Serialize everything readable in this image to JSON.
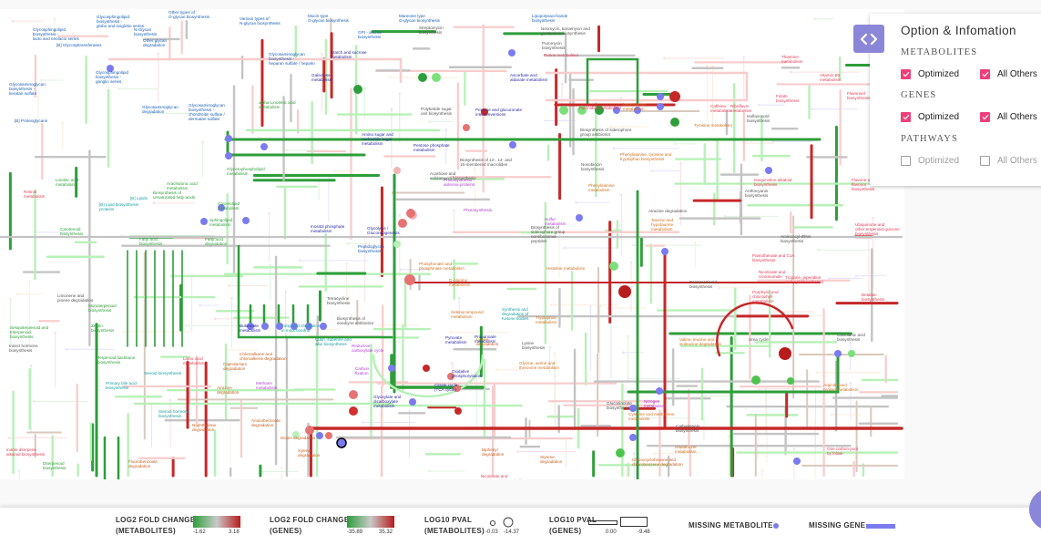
{
  "panel": {
    "title": "Option & Infomation",
    "toggle_icon": "code-brackets-icon",
    "sections": [
      {
        "name": "METABOLITES",
        "options": [
          {
            "label": "Optimized",
            "checked": true
          },
          {
            "label": "All Others",
            "checked": true
          }
        ]
      },
      {
        "name": "GENES",
        "options": [
          {
            "label": "Optimized",
            "checked": true
          },
          {
            "label": "All Others",
            "checked": true
          }
        ]
      },
      {
        "name": "PATHWAYS",
        "options": [
          {
            "label": "Optimized",
            "checked": false
          },
          {
            "label": "All Others",
            "checked": false
          }
        ]
      }
    ]
  },
  "legend": {
    "fc_metabolites": {
      "title1": "LOG2 FOLD CHANGE",
      "title2": "(METABOLITES)",
      "min": "-1.62",
      "max": "3.18"
    },
    "fc_genes": {
      "title1": "LOG2 FOLD CHANGE",
      "title2": "(GENES)",
      "min": "-35.89",
      "max": "35.32"
    },
    "pval_metabolites": {
      "title1": "LOG10 PVAL",
      "title2": "(METABOLITES)",
      "min": "-0.03",
      "max": "-14.37"
    },
    "pval_genes": {
      "title1": "LOG10 PVAL",
      "title2": "(GENES)",
      "min": "0.00",
      "max": "-9.48"
    },
    "missing_metabolite": "MISSING METABOLITE",
    "missing_gene": "MISSING GENE"
  },
  "colors": {
    "accent": "#8b87d8",
    "checkbox": "#ef3f7b",
    "up": "#c62828",
    "down": "#2e9e3a",
    "missing": "#7b7bf0",
    "neutral": "#c4c4c4"
  },
  "pathways": [
    {
      "text": "Glycosphingolipid\nbiosynthesis -\nglobo and isoglobo series",
      "color": "#1a5fb4"
    },
    {
      "text": "Other types of\nO-glycan biosynthesis",
      "color": "#1a5fb4"
    },
    {
      "text": "Various types of\nN-glycan biosynthesis",
      "color": "#1a5fb4"
    },
    {
      "text": "Mucin type\nO-glycan biosynthesis",
      "color": "#1a5fb4"
    },
    {
      "text": "Mannose type\nO-glycan biosynthesis",
      "color": "#1a5fb4"
    },
    {
      "text": "Lipopolysaccharide\nbiosynthesis",
      "color": "#1a5fb4"
    },
    {
      "text": "Glycosphingolipid\nbiosynthesis -\nlacto and neolacto series",
      "color": "#1a5fb4"
    },
    {
      "text": "N-Glycan\nbiosynthesis",
      "color": "#1a5fb4"
    },
    {
      "text": "[B] Glycosyltransferases",
      "color": "#1a5fb4"
    },
    {
      "text": "Other glycan\ndegradation",
      "color": "#1a5fb4"
    },
    {
      "text": "Glycosphingolipid\nbiosynthesis -\nganglio series",
      "color": "#1a5fb4"
    },
    {
      "text": "Glycosaminoglycan\nbiosynthesis -\nheparan sulfate / heparin",
      "color": "#1a5fb4"
    },
    {
      "text": "GPI - anchor\nbiosynthesis",
      "color": "#1a5fb4"
    },
    {
      "text": "Streptomycin\nbiosynthesis",
      "color": "#555555"
    },
    {
      "text": "Neomycin, kanamycin and\ngentamicin biosynthesis",
      "color": "#555555"
    },
    {
      "text": "Puromycin\nbiosynthesis",
      "color": "#555555"
    },
    {
      "text": "Purine metabolism",
      "color": "#e0405a"
    },
    {
      "text": "Starch and sucrose\nmetabolism",
      "color": "#2a2aa0"
    },
    {
      "text": "Galactose\nmetabolism",
      "color": "#2a2aa0"
    },
    {
      "text": "Ascorbate and\naldarate metabolism",
      "color": "#2a2aa0"
    },
    {
      "text": "Glycosaminoglycan\nbiosynthesis -\nkeratan sulfate",
      "color": "#1a5fb4"
    },
    {
      "text": "[B] Proteoglycans",
      "color": "#1a5fb4"
    },
    {
      "text": "Glycosaminoglycan\ndegradation",
      "color": "#1a5fb4"
    },
    {
      "text": "Glycosaminoglycan\nbiosynthesis -\nchondroitin sulfate /\ndermatan sulfate",
      "color": "#1a5fb4"
    },
    {
      "text": "alpha-Linolenic acid\nmetabolism",
      "color": "#2e9e3a"
    },
    {
      "text": "Polyketide sugar\nunit biosynthesis",
      "color": "#555555"
    },
    {
      "text": "Pentose and glucuronate\ninterconversions",
      "color": "#2a2aa0"
    },
    {
      "text": "Pyrimidine metabolism",
      "color": "#e0405a"
    },
    {
      "text": "beta-Alanine\nmetabolism",
      "color": "#d07020"
    },
    {
      "text": "Caffeine\nmetabolism",
      "color": "#e0405a"
    },
    {
      "text": "Riboflavin\nmetabolism",
      "color": "#e0405a"
    },
    {
      "text": "Thiamine\nmetabolism",
      "color": "#e0405a"
    },
    {
      "text": "Folate\nbiosynthesis",
      "color": "#e0405a"
    },
    {
      "text": "Vitamin B6\nmetabolism",
      "color": "#e0405a"
    },
    {
      "text": "Flavonoid\nbiosynthesis",
      "color": "#e0405a"
    },
    {
      "text": "Isoflavonoid\nbiosynthesis",
      "color": "#555555"
    },
    {
      "text": "Tyrosine metabolism",
      "color": "#d07020"
    },
    {
      "text": "Biosynthesis of siderophore\ngroup antibiotics",
      "color": "#555555"
    },
    {
      "text": "Amino sugar and\nnucleotide sugar\nmetabolism",
      "color": "#2a2aa0"
    },
    {
      "text": "Pentose phosphate\nmetabolism",
      "color": "#2a2aa0"
    },
    {
      "text": "Biosynthesis of 12-, 14- and\n16-membered macrolides",
      "color": "#555555"
    },
    {
      "text": "Acarbose and\nvalidamycin biosynthesis",
      "color": "#555555"
    },
    {
      "text": "Photosynthesis -\nantenna proteins",
      "color": "#b040d0"
    },
    {
      "text": "Photosynthesis",
      "color": "#b040d0"
    },
    {
      "text": "Phenylalanine, tyrosine and\ntryptophan biosynthesis",
      "color": "#d07020"
    },
    {
      "text": "Phenylalanine\nmetabolism",
      "color": "#d07020"
    },
    {
      "text": "Novobiocin\nbiosynthesis",
      "color": "#555555"
    },
    {
      "text": "Linoleic acid\nmetabolism",
      "color": "#2e9e3a"
    },
    {
      "text": "Retinol\nmetabolism",
      "color": "#e0405a"
    },
    {
      "text": "Arachidonic acid\nmetabolism",
      "color": "#2e9e3a"
    },
    {
      "text": "Biosynthesis of\nunsaturated fatty acids",
      "color": "#2e9e3a"
    },
    {
      "text": "[B] Lipids",
      "color": "#1aa0a0"
    },
    {
      "text": "[B] Lipid biosynthesis\nproteins",
      "color": "#1aa0a0"
    },
    {
      "text": "Glycerophospholipid\nmetabolism",
      "color": "#2e9e3a"
    },
    {
      "text": "Glycerolipid\nmetabolism",
      "color": "#2e9e3a"
    },
    {
      "text": "Sphingolipid\nmetabolism",
      "color": "#2e9e3a"
    },
    {
      "text": "Inositol phosphate\nmetabolism",
      "color": "#2a2aa0"
    },
    {
      "text": "Glycolysis /\nGluconeogenesis",
      "color": "#2a2aa0"
    },
    {
      "text": "Peptidoglycan\nbiosynthesis",
      "color": "#1a5fb4"
    },
    {
      "text": "Pyruvate\nmetabolism",
      "color": "#2a2aa0"
    },
    {
      "text": "Carotenoid\nbiosynthesis",
      "color": "#2e9e3a"
    },
    {
      "text": "Fatty acid\nbiosynthesis",
      "color": "#2e9e3a"
    },
    {
      "text": "Fatty acid\ndegradation",
      "color": "#2e9e3a"
    },
    {
      "text": "Sulfur\nmetabolism",
      "color": "#b040d0"
    },
    {
      "text": "Biosynthesis of\nsiderophore group\nnonribosomal\npeptides",
      "color": "#555555"
    },
    {
      "text": "Phosphonate and\nphosphinate metabolism",
      "color": "#d07020"
    },
    {
      "text": "D-Alanine\nmetabolism",
      "color": "#d07020"
    },
    {
      "text": "Histidine metabolism",
      "color": "#d07020"
    },
    {
      "text": "Taurine and\nhypotaurine\nmetabolism",
      "color": "#d07020"
    },
    {
      "text": "Atrazine degradation",
      "color": "#555555"
    },
    {
      "text": "Limonene and\npinene degradation",
      "color": "#555555"
    },
    {
      "text": "Monoterpenoid\nbiosynthesis",
      "color": "#2e9e3a"
    },
    {
      "text": "Zeatin\nbiosynthesis",
      "color": "#2e9e3a"
    },
    {
      "text": "Sesquiterpenoid and\ntriterpenoid\nbiosynthesis",
      "color": "#2e9e3a"
    },
    {
      "text": "Insect hormone\nbiosynthesis",
      "color": "#555555"
    },
    {
      "text": "Terpenoid backbone\nbiosynthesis",
      "color": "#2e9e3a"
    },
    {
      "text": "Butanoate\nmetabolism",
      "color": "#2a2aa0"
    },
    {
      "text": "Fatty acid elongation\nin mitochondria",
      "color": "#1aa0a0"
    },
    {
      "text": "Tetracycline\nbiosynthesis",
      "color": "#555555"
    },
    {
      "text": "Biosynthesis of\nenediyne antibiotics",
      "color": "#555555"
    },
    {
      "text": "Cutin, suberine and\nwax biosynthesis",
      "color": "#1aa0a0"
    },
    {
      "text": "Reductive\ncarboxylate cycle",
      "color": "#b040d0"
    },
    {
      "text": "Carbon\nfixation",
      "color": "#b040d0"
    },
    {
      "text": "Chloroalkane and\nchloroalkene degradation",
      "color": "#c86020"
    },
    {
      "text": "Lipoic acid\nmetabolism",
      "color": "#e0405a"
    },
    {
      "text": "Caprolactam\ndegradation",
      "color": "#c86020"
    },
    {
      "text": "Steroid biosynthesis",
      "color": "#1aa0a0"
    },
    {
      "text": "Primary bile acid\nbiosynthesis",
      "color": "#1aa0a0"
    },
    {
      "text": "Steroid hormone\nbiosynthesis",
      "color": "#1aa0a0"
    },
    {
      "text": "Atrazine\ndegradation",
      "color": "#c86020"
    },
    {
      "text": "Methane\nmetabolism",
      "color": "#b040d0"
    },
    {
      "text": "Naphthalene\ndegradation",
      "color": "#c86020"
    },
    {
      "text": "Aminobenzoate\ndegradation",
      "color": "#c86020"
    },
    {
      "text": "Dioxin degradation",
      "color": "#c86020"
    },
    {
      "text": "Xylene\ndegradation",
      "color": "#c86020"
    },
    {
      "text": "Fluorobenzoate\ndegradation",
      "color": "#c86020"
    },
    {
      "text": "Indole diterpene\nalkaloid biosynthesis",
      "color": "#e0405a"
    },
    {
      "text": "Diterpenoid\nbiosynthesis",
      "color": "#2e9e3a"
    },
    {
      "text": "Glyoxylate and\ndicarboxylate\nmetabolism",
      "color": "#2a2aa0"
    },
    {
      "text": "Citrate cycle\n(TCA cycle)",
      "color": "#2a2aa0"
    },
    {
      "text": "Oxidative\nphosphorylation",
      "color": "#2a2aa0"
    },
    {
      "text": "Propanoate\nmetabolism",
      "color": "#2a2aa0"
    },
    {
      "text": "Lysine\ndegradation",
      "color": "#c86020"
    },
    {
      "text": "Lysine\nbiosynthesis",
      "color": "#555555"
    },
    {
      "text": "Selenocompound\nmetabolism",
      "color": "#d07020"
    },
    {
      "text": "Synthesis and\ndegradation of\nKetone bodies",
      "color": "#1aa0a0"
    },
    {
      "text": "Glycine, serine and\nthreonine metabolism",
      "color": "#d07020"
    },
    {
      "text": "Tryptophan\nmetabolism",
      "color": "#d07020"
    },
    {
      "text": "Valine, leucine and\nisoleucine degradation",
      "color": "#d07020"
    },
    {
      "text": "Urea cycle",
      "color": "#555555"
    },
    {
      "text": "Clavulanic acid\nbiosynthesis",
      "color": "#555555"
    },
    {
      "text": "Arginine and\nproline metabolism",
      "color": "#d07020"
    },
    {
      "text": "Nitrogen\nmetabolism",
      "color": "#b040d0"
    },
    {
      "text": "Glucosinolate\nbiosynthesis",
      "color": "#555555"
    },
    {
      "text": "Cysteine and methionine\nmetabolism",
      "color": "#d07020"
    },
    {
      "text": "Carbapenem\nbiosynthesis",
      "color": "#555555"
    },
    {
      "text": "Glutathione\nmetabolism",
      "color": "#d07020"
    },
    {
      "text": "Chlorocyclohexane and\nchlorobenzene degradation",
      "color": "#c86020"
    },
    {
      "text": "Biphenyl\ndegradation",
      "color": "#c86020"
    },
    {
      "text": "Styrene\ndegradation",
      "color": "#c86020"
    },
    {
      "text": "Nicotinate and\nnicotinamide metabolism",
      "color": "#e0405a"
    },
    {
      "text": "One carbon pool\nby folate",
      "color": "#e0405a"
    },
    {
      "text": "Isoquinoline alkaloid\nbiosynthesis",
      "color": "#e0405a"
    },
    {
      "text": "Anthocyanin\nbiosynthesis",
      "color": "#555555"
    },
    {
      "text": "Flavone and\nflavonol\nbiosynthesis",
      "color": "#e0405a"
    },
    {
      "text": "Ubiquinone and\nother terpenoid-quinone\nbiosynthesis",
      "color": "#e0405a"
    },
    {
      "text": "Pantothenate and CoA\nbiosynthesis",
      "color": "#e0405a"
    },
    {
      "text": "Porphyrin and\nchlorophyll\nmetabolism",
      "color": "#e0405a"
    },
    {
      "text": "Betalain\nbiosynthesis",
      "color": "#e0405a"
    },
    {
      "text": "Aminoacyl-tRNA\nbiosynthesis",
      "color": "#555555"
    },
    {
      "text": "Benzoxazinoid\nbiosynthesis",
      "color": "#555555"
    },
    {
      "text": "Tropane, piperidine\nand pyridine alkaloid",
      "color": "#e0405a"
    },
    {
      "text": "Nicotinate and\nnicotinamide",
      "color": "#e0405a"
    }
  ]
}
